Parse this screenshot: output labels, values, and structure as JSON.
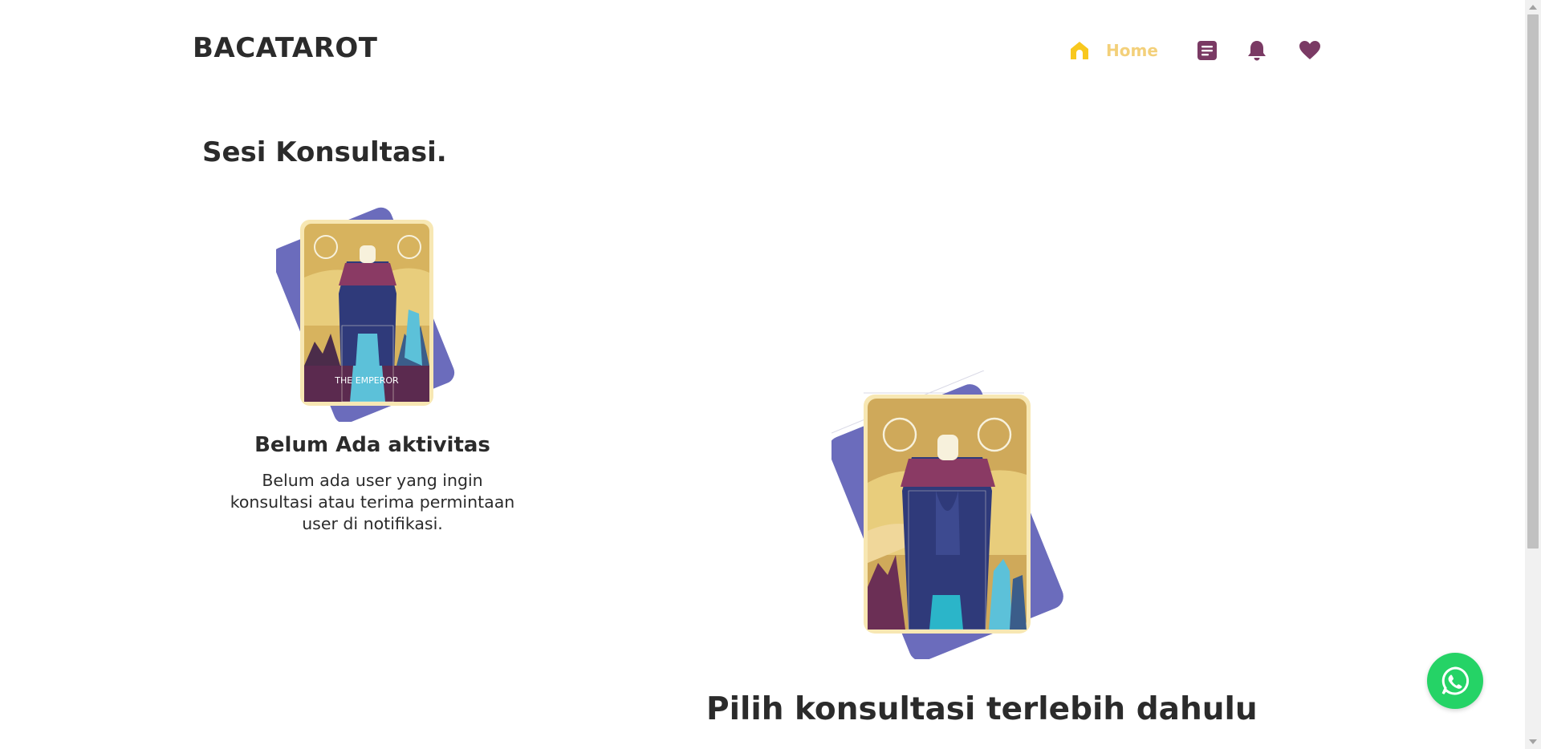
{
  "header": {
    "brand": "BACATAROT",
    "nav": {
      "home_label": "Home",
      "home_icon": "home-icon",
      "icons": [
        "document-icon",
        "bell-icon",
        "heart-icon"
      ]
    }
  },
  "session": {
    "title": "Sesi Konsultasi.",
    "empty_state": {
      "card_caption": "THE EMPEROR",
      "heading": "Belum Ada aktivitas",
      "description": "Belum ada user yang ingin konsultasi atau terima permintaan user di notifikasi."
    }
  },
  "main": {
    "prompt": "Pilih konsultasi terlebih dahulu"
  },
  "floating": {
    "whatsapp_icon": "whatsapp-icon"
  },
  "colors": {
    "accent_yellow": "#f3d07a",
    "home_icon_yellow": "#f8c81e",
    "nav_purple": "#7a3a64",
    "card_gold": "#e4c77a",
    "card_back_blue": "#6b6cbc",
    "robe_navy": "#2f3a7a",
    "whatsapp_green": "#25d366"
  }
}
